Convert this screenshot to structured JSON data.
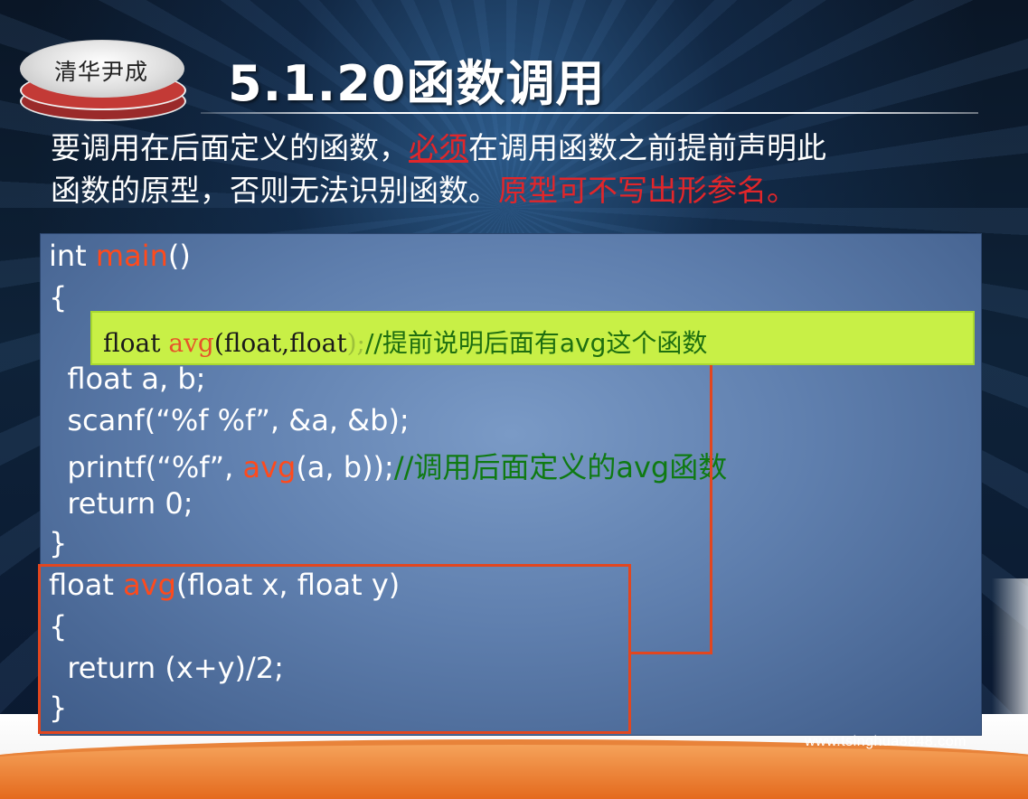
{
  "logo": {
    "text": "清华尹成"
  },
  "slide": {
    "title": "5.1.20函数调用",
    "desc_parts": {
      "p1": "要调用在后面定义的函数，",
      "p2_red_underlined": "必须",
      "p3": "在调用函数之前提前声明此",
      "p4": "函数的原型，否则无法识别函数。",
      "p5_red": "原型可不写出形参名。"
    }
  },
  "code": {
    "line1_a": "int ",
    "line1_b": "main",
    "line1_c": "()",
    "line2": "{",
    "line3": "  float a, b;",
    "line4": "  scanf(“%f %f”, &a, &b);",
    "line5_a": "  printf(“%f”, ",
    "line5_b": "avg",
    "line5_c": "(a, b));",
    "line5_d": "//调用后面定义的avg函数",
    "line6": "  return 0;",
    "line7": "}",
    "line8_a": "float ",
    "line8_b": "avg",
    "line8_c": "(float x, float y)",
    "line9": "{",
    "line10": "  return (x+y)/2;",
    "line11": "}"
  },
  "callout": {
    "a": "float ",
    "b": "avg",
    "c": "(float,float",
    "d": ");",
    "e": "//提前说明后面有avg这个函数"
  },
  "watermark": "www.tsinghua8848.com",
  "colors": {
    "red_keyword": "#ff4a1c",
    "comment_green": "#0f7a12",
    "callout_bg": "#c8f046",
    "box_border": "#e2461f",
    "desc_red": "#e1262a"
  }
}
